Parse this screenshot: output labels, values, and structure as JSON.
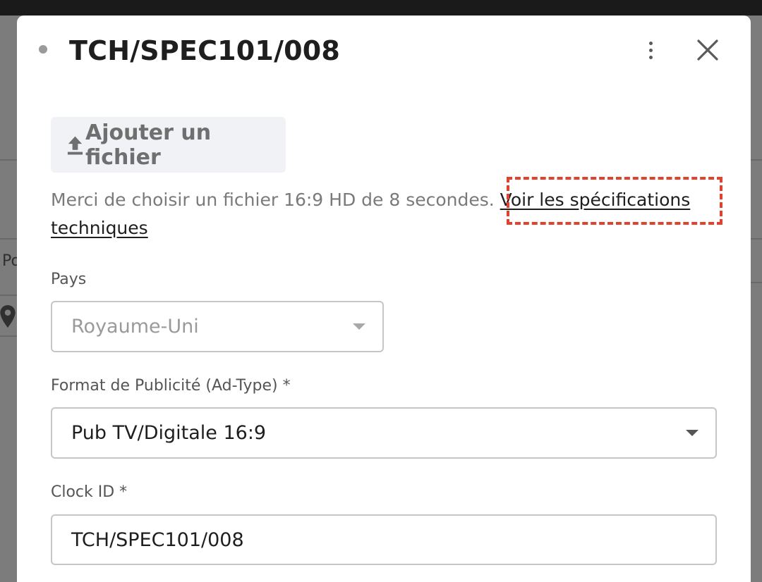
{
  "background": {
    "fragment_text": "Po"
  },
  "modal": {
    "title": "TCH/SPEC101/008",
    "more_icon": "more-vertical-icon",
    "close_icon": "close-icon"
  },
  "upload": {
    "label": "Ajouter un fichier",
    "icon": "upload-icon"
  },
  "help": {
    "text": "Merci de choisir un fichier 16:9 HD de 8 secondes.",
    "link_text": "Voir les spécifications techniques",
    "highlight_color": "#e0422e"
  },
  "fields": {
    "country": {
      "label": "Pays",
      "value": "Royaume-Uni"
    },
    "ad_format": {
      "label": "Format de Publicité (Ad-Type) *",
      "value": "Pub TV/Digitale 16:9"
    },
    "clock_id": {
      "label": "Clock ID *",
      "value": "TCH/SPEC101/008"
    }
  }
}
